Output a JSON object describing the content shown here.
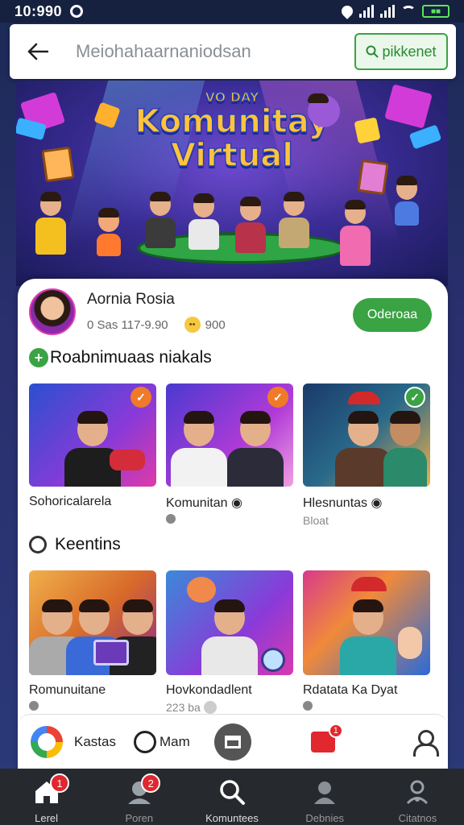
{
  "status_bar": {
    "time": "10:990"
  },
  "header": {
    "title": "Meiohahaarnaniodsan",
    "search_label": "pikkenet"
  },
  "banner": {
    "title_line1": "Komunitay",
    "title_line2": "Virtual",
    "title_small": "VO DAY"
  },
  "profile": {
    "name": "Aornia Rosia",
    "meta": "0 Sas 117-9.90",
    "reaction_count": "900",
    "follow_label": "Oderoaa"
  },
  "section1": {
    "title": "Roabnimuaas niakals",
    "tiles": [
      {
        "label": "Sohoricalarela",
        "sub": ""
      },
      {
        "label": "Komunitan",
        "sub": ""
      },
      {
        "label": "Hlesnuntas",
        "sub": "Bloat"
      }
    ]
  },
  "section2": {
    "title": "Keentins",
    "tiles": [
      {
        "label": "Romunuitane",
        "sub": ""
      },
      {
        "label": "Hovkondadlent",
        "sub": "223 ba"
      },
      {
        "label": "Rdatata Ka Dyat",
        "sub": ""
      }
    ]
  },
  "inner_bar": {
    "label1": "Kastas",
    "label2": "Mam",
    "msg_badge": "1"
  },
  "bottom_nav": [
    {
      "label": "Lerel",
      "badge": "1",
      "icon": "home-icon"
    },
    {
      "label": "Poren",
      "badge": "2",
      "icon": "chat-people-icon"
    },
    {
      "label": "Komuntees",
      "badge": "",
      "icon": "search-icon"
    },
    {
      "label": "Debnies",
      "badge": "",
      "icon": "profile-icon"
    },
    {
      "label": "Citatnos",
      "badge": "",
      "icon": "settings-user-icon"
    }
  ],
  "colors": {
    "accent_green": "#3aa344",
    "badge_red": "#e0282e",
    "nav_bg": "#26292e"
  }
}
